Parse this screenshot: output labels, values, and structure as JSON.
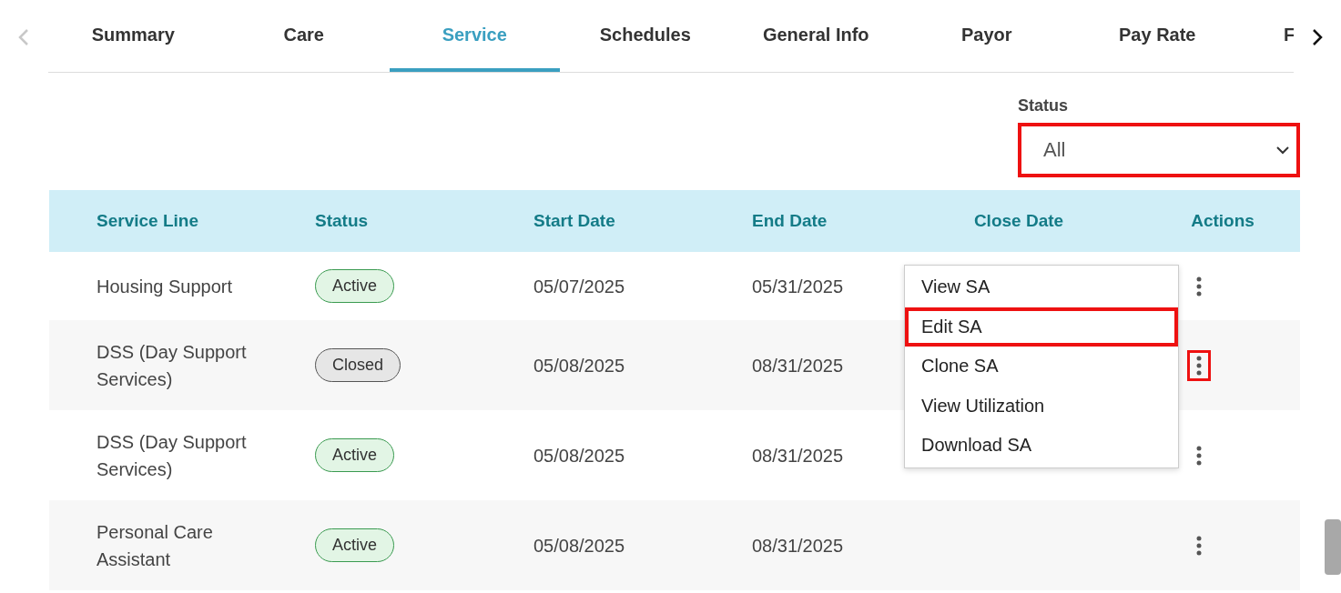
{
  "tabs": [
    {
      "label": "Summary",
      "selected": false
    },
    {
      "label": "Care",
      "selected": false
    },
    {
      "label": "Service",
      "selected": true
    },
    {
      "label": "Schedules",
      "selected": false
    },
    {
      "label": "General Info",
      "selected": false
    },
    {
      "label": "Payor",
      "selected": false
    },
    {
      "label": "Pay Rate",
      "selected": false
    },
    {
      "label": "F",
      "selected": false
    }
  ],
  "tab_scroll": {
    "left_disabled": true,
    "right_disabled": false
  },
  "status_filter": {
    "label": "Status",
    "value": "All",
    "highlighted": true
  },
  "table": {
    "columns": [
      "Service Line",
      "Status",
      "Start Date",
      "End Date",
      "Close Date",
      "Actions"
    ],
    "rows": [
      {
        "service_line": "Housing Support",
        "status": {
          "label": "Active",
          "kind": "active"
        },
        "start_date": "05/07/2025",
        "end_date": "05/31/2025",
        "actions_highlighted": false
      },
      {
        "service_line": "DSS (Day Support Services)",
        "status": {
          "label": "Closed",
          "kind": "closed"
        },
        "start_date": "05/08/2025",
        "end_date": "08/31/2025",
        "actions_highlighted": true
      },
      {
        "service_line": "DSS (Day Support Services)",
        "status": {
          "label": "Active",
          "kind": "active"
        },
        "start_date": "05/08/2025",
        "end_date": "08/31/2025",
        "actions_highlighted": false
      },
      {
        "service_line": "Personal Care Assistant",
        "status": {
          "label": "Active",
          "kind": "active"
        },
        "start_date": "05/08/2025",
        "end_date": "08/31/2025",
        "actions_highlighted": false
      }
    ]
  },
  "actions_menu": {
    "items": [
      {
        "label": "View SA",
        "highlighted": false
      },
      {
        "label": "Edit SA",
        "highlighted": true
      },
      {
        "label": "Clone SA",
        "highlighted": false
      },
      {
        "label": "View Utilization",
        "highlighted": false
      },
      {
        "label": "Download SA",
        "highlighted": false
      }
    ]
  }
}
